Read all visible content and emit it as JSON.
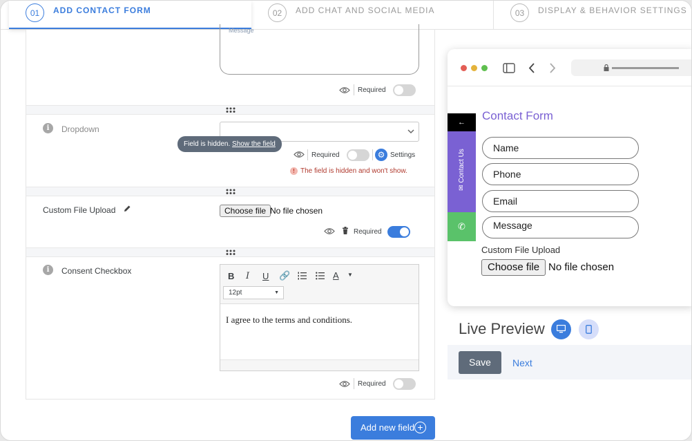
{
  "steps": [
    {
      "num": "01",
      "label": "ADD CONTACT FORM"
    },
    {
      "num": "02",
      "label": "ADD CHAT AND SOCIAL MEDIA"
    },
    {
      "num": "03",
      "label": "DISPLAY & BEHAVIOR SETTINGS"
    }
  ],
  "form": {
    "message_placeholder": "Message",
    "required_label": "Required",
    "dropdown": {
      "label": "Dropdown",
      "tooltip_text": "Field is hidden.",
      "tooltip_link": "Show the field",
      "settings_label": "Settings",
      "hidden_warning": "The field is hidden and won't show."
    },
    "file_upload": {
      "label": "Custom File Upload",
      "choose_label": "Choose file",
      "no_file": "No file chosen"
    },
    "consent": {
      "label": "Consent Checkbox",
      "font_size": "12pt",
      "text": "I agree to the terms and conditions."
    },
    "add_field_label": "Add new field"
  },
  "preview": {
    "side_tab_label": "Contact Us",
    "title": "Contact Form",
    "fields": [
      "Name",
      "Phone",
      "Email",
      "Message"
    ],
    "upload_label": "Custom File Upload",
    "choose_label": "Choose file",
    "no_file": "No file chosen",
    "live_preview_label": "Live Preview",
    "save_label": "Save",
    "next_label": "Next"
  },
  "colors": {
    "accent": "#3b7ddd",
    "purple": "#7a61d3",
    "green": "#5ac26a",
    "title_purple": "#7a61d3"
  },
  "icons": [
    "info-icon",
    "eye-icon",
    "pencil-icon",
    "trash-icon",
    "gear-icon",
    "whatsapp-icon",
    "mail-icon",
    "desktop-icon",
    "mobile-icon",
    "plus-circle-icon",
    "sidebar-icon",
    "chevron-left-icon",
    "chevron-right-icon",
    "lock-icon",
    "arrow-left-icon",
    "drag-handle-icon"
  ]
}
